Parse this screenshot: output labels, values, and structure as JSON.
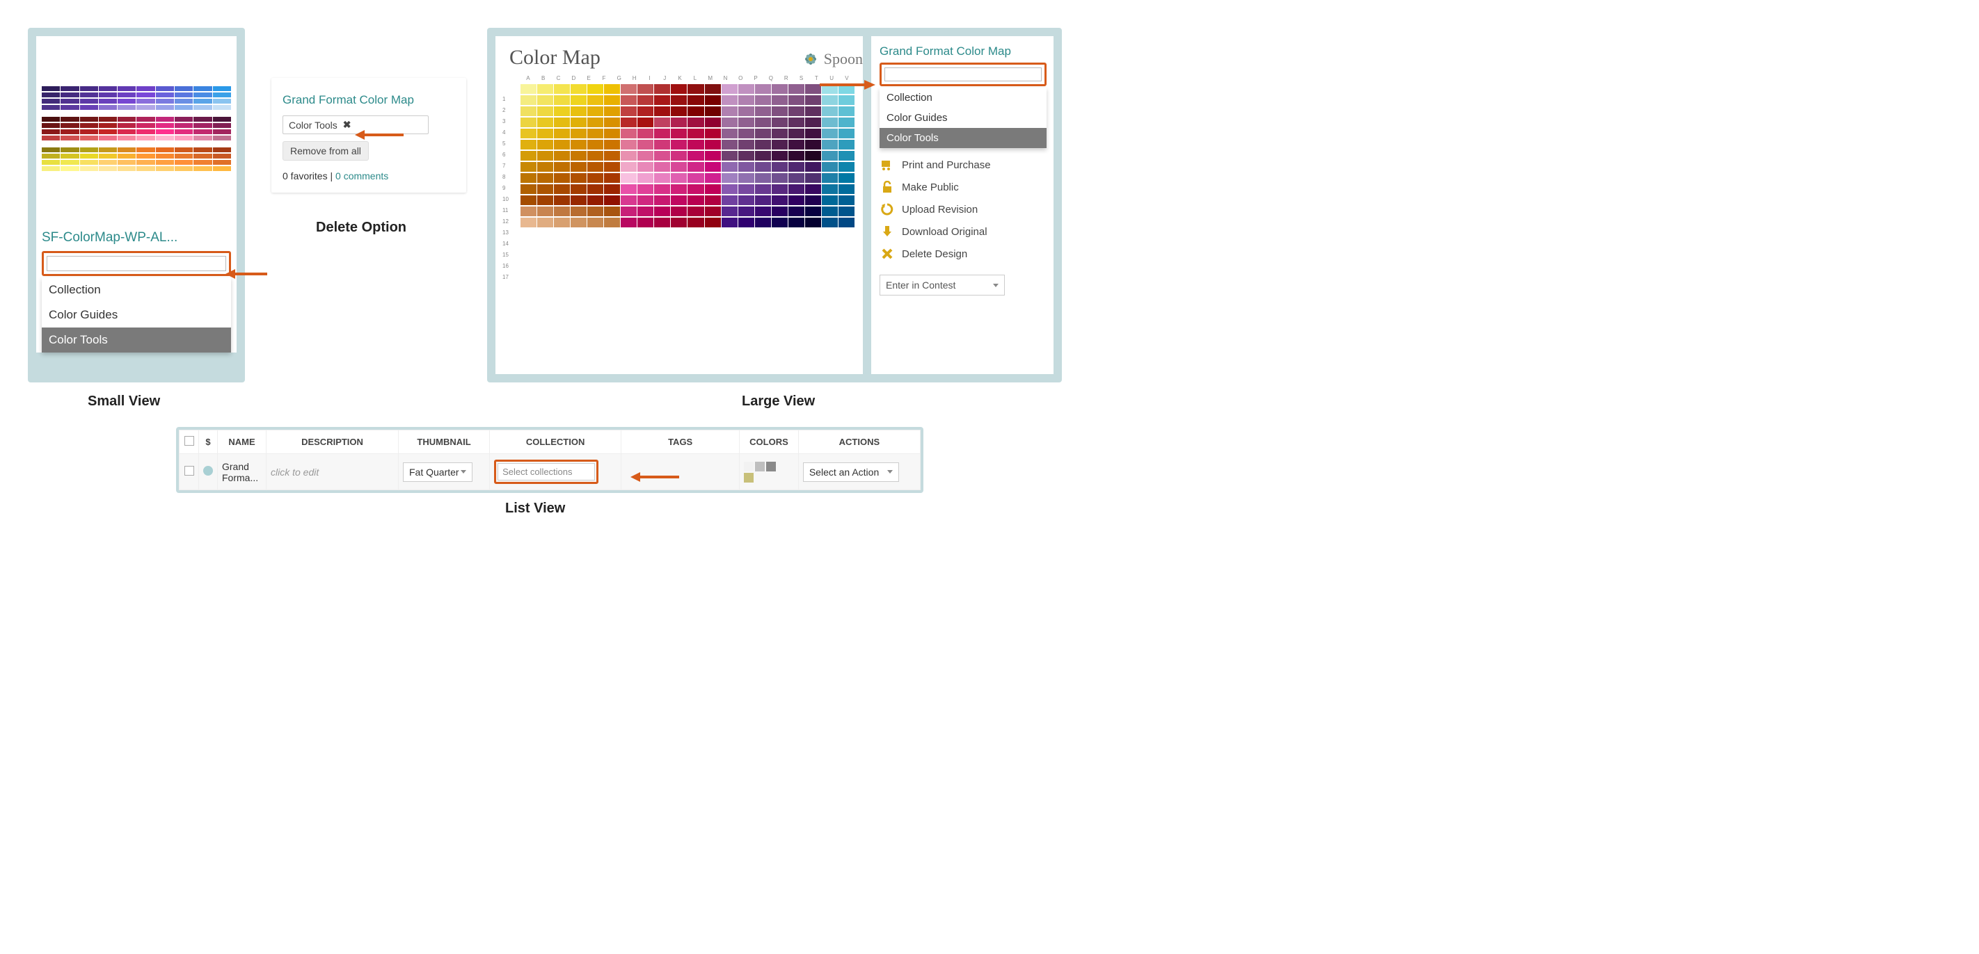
{
  "small_view": {
    "title": "SF-ColorMap-WP-AL...",
    "dropdown": {
      "items": [
        "Collection",
        "Color Guides",
        "Color Tools"
      ],
      "selected_index": 2
    },
    "caption": "Small View"
  },
  "delete_option": {
    "title": "Grand Format Color Map",
    "chip_label": "Color Tools",
    "remove_label": "Remove from all",
    "favorites_text": "0 favorites",
    "separator": " | ",
    "comments_link": "0 comments",
    "caption": "Delete Option"
  },
  "large_view": {
    "image_title": "Color Map",
    "brand": "Spoon",
    "col_letters": [
      "A",
      "B",
      "C",
      "D",
      "E",
      "F",
      "G",
      "H",
      "I",
      "J",
      "K",
      "L",
      "M",
      "N",
      "O",
      "P",
      "Q",
      "R",
      "S",
      "T",
      "U",
      "V"
    ],
    "row_numbers": [
      "1",
      "2",
      "3",
      "4",
      "5",
      "6",
      "7",
      "8",
      "9",
      "10",
      "11",
      "12",
      "13",
      "14",
      "15",
      "16",
      "17"
    ],
    "side": {
      "title": "Grand Format Color Map",
      "dropdown": {
        "items": [
          "Collection",
          "Color Guides",
          "Color Tools"
        ],
        "selected_index": 2
      },
      "actions": {
        "print": "Print and Purchase",
        "public": "Make Public",
        "upload": "Upload Revision",
        "download": "Download Original",
        "delete": "Delete Design"
      },
      "contest_label": "Enter in Contest"
    },
    "caption": "Large View"
  },
  "list_view": {
    "headers": {
      "dollar": "$",
      "name": "NAME",
      "description": "DESCRIPTION",
      "thumbnail": "THUMBNAIL",
      "collection": "COLLECTION",
      "tags": "TAGS",
      "colors": "COLORS",
      "actions": "ACTIONS"
    },
    "row": {
      "name": "Grand Forma...",
      "description_placeholder": "click to edit",
      "thumbnail_select": "Fat Quarter",
      "collection_placeholder": "Select collections",
      "action_select": "Select an Action",
      "swatch_colors": [
        "#f2f2f2",
        "#bfbfbf",
        "#8a8a8a",
        "#c8c07a"
      ]
    },
    "caption": "List View"
  }
}
